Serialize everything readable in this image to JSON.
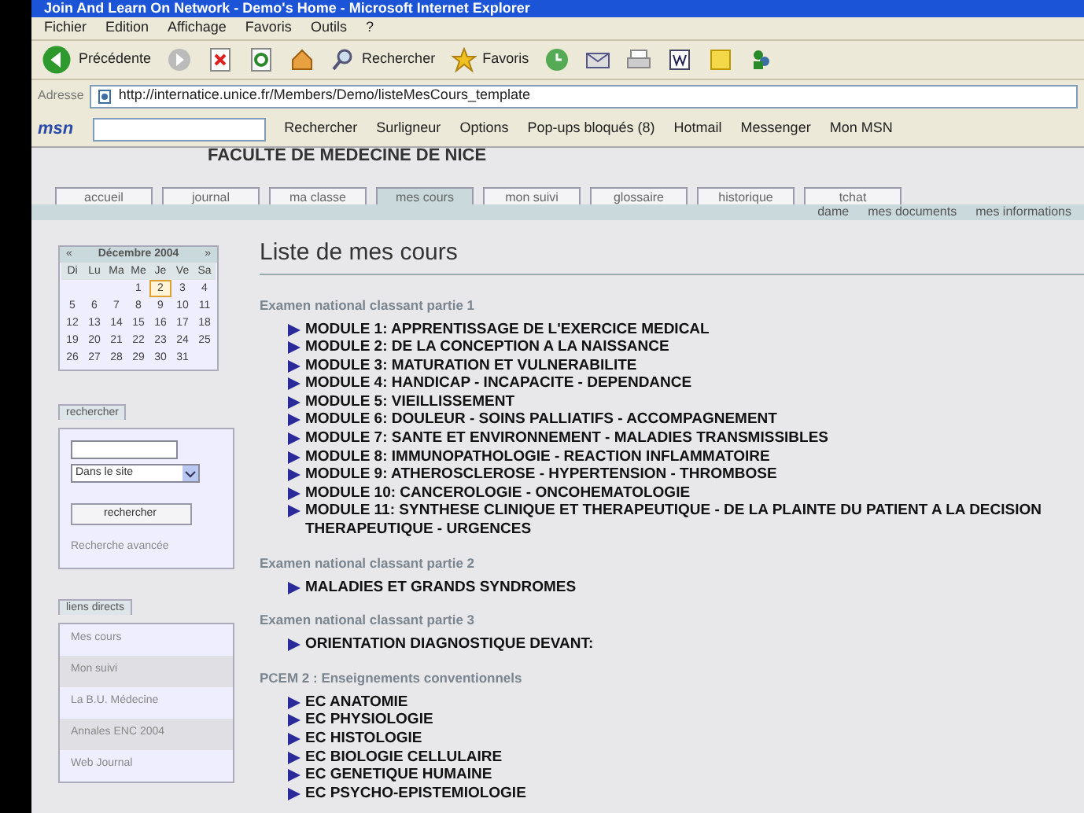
{
  "window": {
    "title": "Join And Learn On Network - Demo's Home - Microsoft Internet Explorer"
  },
  "menu": [
    "Fichier",
    "Edition",
    "Affichage",
    "Favoris",
    "Outils",
    "?"
  ],
  "toolbar": [
    {
      "kind": "back",
      "label": "Précédente"
    },
    {
      "kind": "forward"
    },
    {
      "kind": "stop"
    },
    {
      "kind": "refresh"
    },
    {
      "kind": "home"
    },
    {
      "kind": "search",
      "label": "Rechercher"
    },
    {
      "kind": "favorites",
      "label": "Favoris"
    },
    {
      "kind": "history"
    },
    {
      "kind": "mail"
    },
    {
      "kind": "print"
    },
    {
      "kind": "word"
    },
    {
      "kind": "note"
    },
    {
      "kind": "messenger"
    }
  ],
  "address": {
    "label": "Adresse",
    "value": "http://internatice.unice.fr/Members/Demo/listeMesCours_template"
  },
  "msn_bar": {
    "logo": "msn",
    "items": [
      "Rechercher",
      "Surligneur",
      "Options",
      "Pop-ups bloqués (8)",
      "Hotmail",
      "Messenger",
      "Mon MSN"
    ]
  },
  "site_title": "FACULTE DE MEDECINE DE NICE",
  "tabs": [
    {
      "label": "accueil",
      "selected": false
    },
    {
      "label": "journal",
      "selected": false
    },
    {
      "label": "ma classe",
      "selected": false
    },
    {
      "label": "mes cours",
      "selected": true
    },
    {
      "label": "mon suivi",
      "selected": false
    },
    {
      "label": "glossaire",
      "selected": false
    },
    {
      "label": "historique",
      "selected": false
    },
    {
      "label": "tchat",
      "selected": false
    }
  ],
  "user_links": [
    "dame",
    "mes documents",
    "mes informations"
  ],
  "calendar": {
    "prev": "«",
    "month": "Décembre 2004",
    "next": "»",
    "weekdays": [
      "Di",
      "Lu",
      "Ma",
      "Me",
      "Je",
      "Ve",
      "Sa"
    ],
    "weeks": [
      [
        {
          "day": "1",
          "selected": false
        },
        {
          "day": "2",
          "selected": true
        },
        {
          "day": "3",
          "selected": false
        },
        {
          "day": "4",
          "selected": false
        }
      ],
      [
        {
          "day": "5",
          "selected": false
        },
        {
          "day": "6",
          "selected": false
        },
        {
          "day": "7",
          "selected": false
        },
        {
          "day": "8",
          "selected": false
        },
        {
          "day": "9",
          "selected": false
        },
        {
          "day": "10",
          "selected": false
        },
        {
          "day": "11",
          "selected": false
        }
      ],
      [
        {
          "day": "12",
          "selected": false
        },
        {
          "day": "13",
          "selected": false
        },
        {
          "day": "14",
          "selected": false
        },
        {
          "day": "15",
          "selected": false
        },
        {
          "day": "16",
          "selected": false
        },
        {
          "day": "17",
          "selected": false
        },
        {
          "day": "18",
          "selected": false
        }
      ],
      [
        {
          "day": "19",
          "selected": false
        },
        {
          "day": "20",
          "selected": false
        },
        {
          "day": "21",
          "selected": false
        },
        {
          "day": "22",
          "selected": false
        },
        {
          "day": "23",
          "selected": false
        },
        {
          "day": "24",
          "selected": false
        },
        {
          "day": "25",
          "selected": false
        }
      ],
      [
        {
          "day": "26",
          "selected": false
        },
        {
          "day": "27",
          "selected": false
        },
        {
          "day": "28",
          "selected": false
        },
        {
          "day": "29",
          "selected": false
        },
        {
          "day": "30",
          "selected": false
        },
        {
          "day": "31",
          "selected": false
        }
      ]
    ]
  },
  "search_box": {
    "title": "rechercher",
    "scope": "Dans le site",
    "button": "rechercher",
    "advanced": "Recherche avancée"
  },
  "direct_links": {
    "title": "liens directs",
    "items": [
      "Mes cours",
      "Mon suivi",
      "La B.U. Médecine",
      "Annales ENC 2004",
      "Web Journal"
    ]
  },
  "heading": "Liste de mes cours",
  "sections": [
    {
      "title": "Examen national classant partie 1",
      "items": [
        "MODULE 1: APPRENTISSAGE DE L'EXERCICE MEDICAL",
        "MODULE 2: DE LA CONCEPTION A LA NAISSANCE",
        "MODULE 3: MATURATION ET VULNERABILITE",
        "MODULE 4: HANDICAP - INCAPACITE - DEPENDANCE",
        "MODULE 5: VIEILLISSEMENT",
        "MODULE 6: DOULEUR - SOINS PALLIATIFS - ACCOMPAGNEMENT",
        "MODULE 7: SANTE ET ENVIRONNEMENT - MALADIES TRANSMISSIBLES",
        "MODULE 8: IMMUNOPATHOLOGIE - REACTION INFLAMMATOIRE",
        "MODULE 9: ATHEROSCLEROSE - HYPERTENSION - THROMBOSE",
        "MODULE 10: CANCEROLOGIE - ONCOHEMATOLOGIE",
        "MODULE 11: SYNTHESE CLINIQUE ET THERAPEUTIQUE - DE LA PLAINTE DU PATIENT A LA DECISION THERAPEUTIQUE - URGENCES"
      ]
    },
    {
      "title": "Examen national classant partie 2",
      "items": [
        "MALADIES ET GRANDS SYNDROMES"
      ]
    },
    {
      "title": "Examen national classant partie 3",
      "items": [
        "ORIENTATION DIAGNOSTIQUE DEVANT:"
      ]
    },
    {
      "title": "PCEM 2 : Enseignements conventionnels",
      "items": [
        "EC ANATOMIE",
        "EC PHYSIOLOGIE",
        "EC HISTOLOGIE",
        "EC BIOLOGIE CELLULAIRE",
        "EC GENETIQUE HUMAINE",
        "EC PSYCHO-EPISTEMIOLOGIE"
      ]
    }
  ]
}
